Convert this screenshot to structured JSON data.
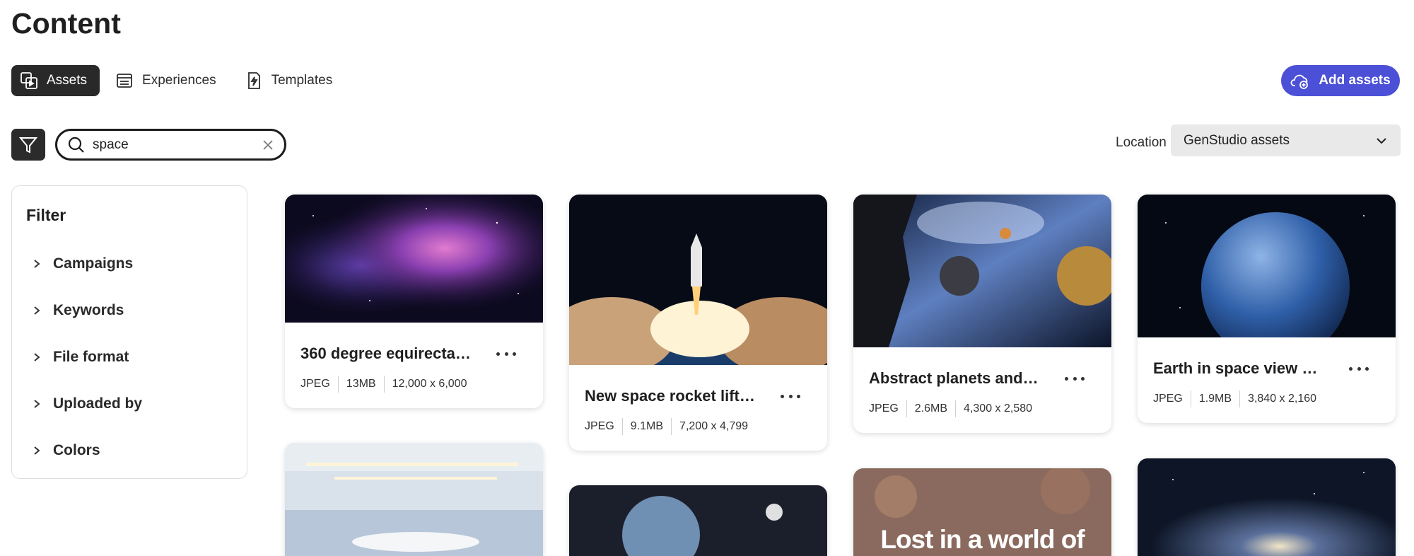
{
  "page": {
    "title": "Content"
  },
  "tabs": [
    {
      "label": "Assets",
      "icon": "assets-icon",
      "active": true
    },
    {
      "label": "Experiences",
      "icon": "experiences-icon",
      "active": false
    },
    {
      "label": "Templates",
      "icon": "templates-icon",
      "active": false
    }
  ],
  "actions": {
    "add_assets_label": "Add assets"
  },
  "search": {
    "value": "space"
  },
  "location": {
    "label": "Location",
    "selected": "GenStudio assets"
  },
  "filter": {
    "title": "Filter",
    "items": [
      "Campaigns",
      "Keywords",
      "File format",
      "Uploaded by",
      "Colors"
    ]
  },
  "assets": [
    {
      "title": "360 degree equirectang...",
      "format": "JPEG",
      "size": "13MB",
      "dimensions": "12,000 x 6,000"
    },
    {
      "title": "New space rocket lift off....",
      "format": "JPEG",
      "size": "9.1MB",
      "dimensions": "7,200 x 4,799"
    },
    {
      "title": "Abstract planets and spa...",
      "format": "JPEG",
      "size": "2.6MB",
      "dimensions": "4,300 x 2,580"
    },
    {
      "title": "Earth in space view with...",
      "format": "JPEG",
      "size": "1.9MB",
      "dimensions": "3,840 x 2,160"
    }
  ],
  "partial_assets": [
    {
      "overlay_text": ""
    },
    {
      "overlay_text": ""
    },
    {
      "overlay_text": "Lost in a world of"
    },
    {
      "overlay_text": ""
    }
  ],
  "colors": {
    "accent": "#4b50d6",
    "dark": "#292929",
    "panel_border": "#dedede"
  }
}
